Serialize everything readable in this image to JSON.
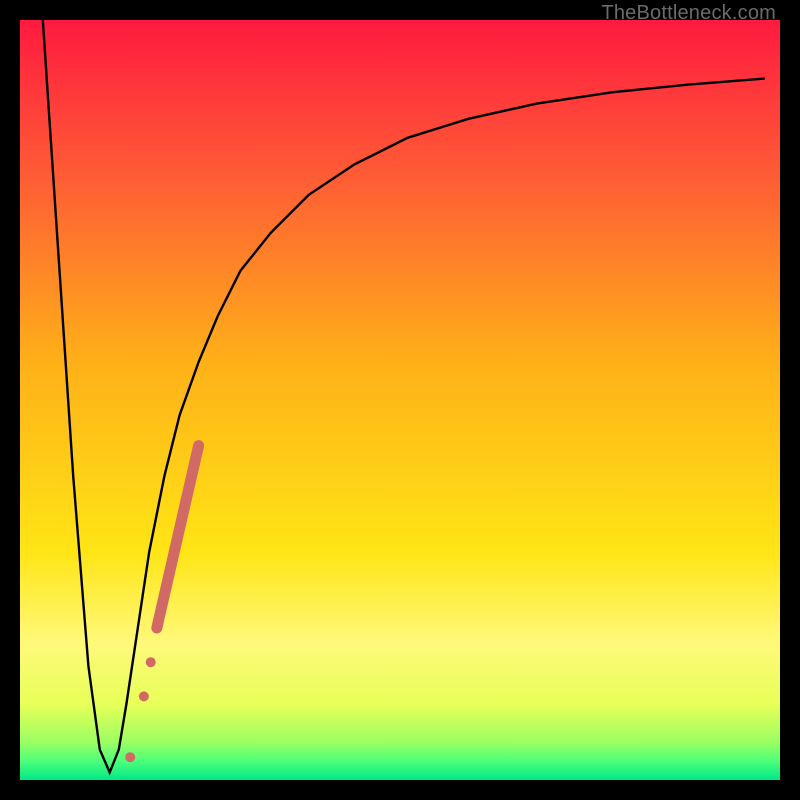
{
  "watermark": "TheBottleneck.com",
  "chart_data": {
    "type": "line",
    "title": "",
    "xlabel": "",
    "ylabel": "",
    "xlim": [
      0,
      100
    ],
    "ylim": [
      0,
      100
    ],
    "grid": false,
    "gradient_stops": [
      {
        "pos": 0.0,
        "color": "#ff1a3f"
      },
      {
        "pos": 0.2,
        "color": "#ff5a36"
      },
      {
        "pos": 0.45,
        "color": "#ffb018"
      },
      {
        "pos": 0.7,
        "color": "#ffe516"
      },
      {
        "pos": 0.82,
        "color": "#fff97a"
      },
      {
        "pos": 0.9,
        "color": "#e7ff58"
      },
      {
        "pos": 0.95,
        "color": "#9cff62"
      },
      {
        "pos": 0.975,
        "color": "#4dff7a"
      },
      {
        "pos": 1.0,
        "color": "#00e887"
      }
    ],
    "series": [
      {
        "name": "bottleneck-curve",
        "x": [
          3,
          5,
          7,
          9,
          10.5,
          11.8,
          13,
          14,
          15.5,
          17,
          19,
          21,
          23.5,
          26,
          29,
          33,
          38,
          44,
          51,
          59,
          68,
          78,
          88,
          98
        ],
        "y": [
          100,
          70,
          40,
          15,
          4,
          1,
          4,
          10,
          20,
          30,
          40,
          48,
          55,
          61,
          67,
          72,
          77,
          81,
          84.5,
          87,
          89,
          90.5,
          91.5,
          92.3
        ]
      }
    ],
    "scatter": {
      "name": "highlight-dots",
      "color": "#d16a65",
      "points": [
        {
          "x": 14.5,
          "y": 3.0,
          "r": 5
        },
        {
          "x": 16.3,
          "y": 11.0,
          "r": 5
        },
        {
          "x": 17.2,
          "y": 15.5,
          "r": 5
        }
      ],
      "band": {
        "from": {
          "x": 18.0,
          "y": 20.0
        },
        "to": {
          "x": 23.5,
          "y": 44.0
        },
        "width": 11
      }
    }
  }
}
